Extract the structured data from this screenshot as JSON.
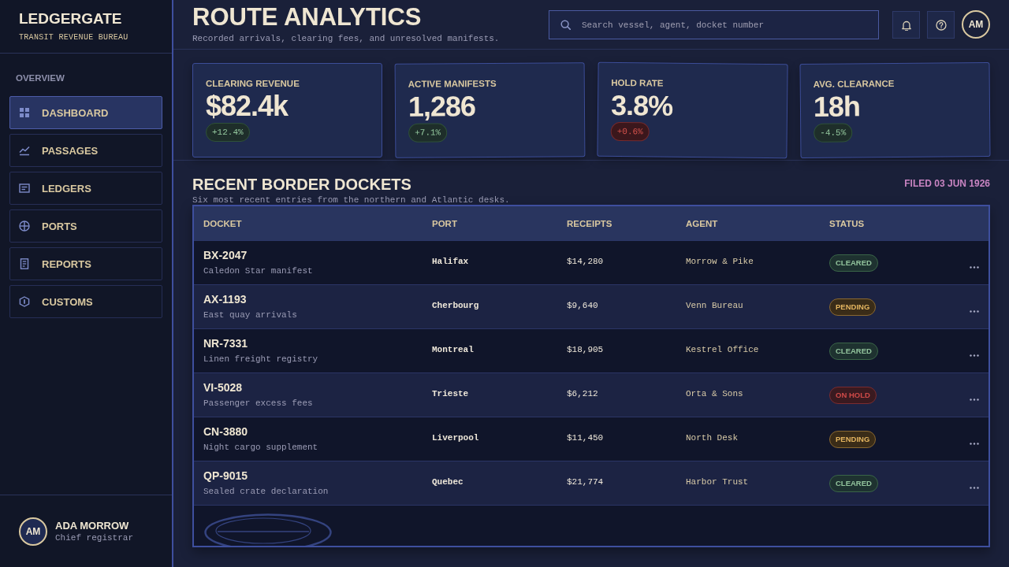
{
  "sidebar": {
    "brand": {
      "name": "LEDGERGATE",
      "tagline": "TRANSIT REVENUE BUREAU"
    },
    "section_label": "OVERVIEW",
    "items": [
      {
        "label": "DASHBOARD",
        "selected": true
      },
      {
        "label": "PASSAGES",
        "selected": false
      },
      {
        "label": "LEDGERS",
        "selected": false
      },
      {
        "label": "PORTS",
        "selected": false
      },
      {
        "label": "REPORTS",
        "selected": false
      },
      {
        "label": "CUSTOMS",
        "selected": false
      }
    ],
    "user": {
      "initials": "AM",
      "name": "ADA MORROW",
      "role": "Chief registrar"
    }
  },
  "header": {
    "title": "ROUTE ANALYTICS",
    "subtitle": "Recorded arrivals, clearing fees, and unresolved manifests.",
    "search": {
      "placeholder": "Search vessel, agent, docket number"
    },
    "account": {
      "initials": "AM"
    }
  },
  "metrics": [
    {
      "label": "CLEARING REVENUE",
      "value": "$82.4k",
      "delta": {
        "text": "+12.4%",
        "kind": "good"
      }
    },
    {
      "label": "ACTIVE MANIFESTS",
      "value": "1,286",
      "delta": {
        "text": "+7.1%",
        "kind": "good"
      }
    },
    {
      "label": "HOLD RATE",
      "value": "3.8%",
      "delta": {
        "text": "+0.6%",
        "kind": "bad"
      }
    },
    {
      "label": "AVG. CLEARANCE",
      "value": "18h",
      "delta": {
        "text": "-4.5%",
        "kind": "good"
      }
    }
  ],
  "dockets": {
    "title": "RECENT BORDER DOCKETS",
    "subtitle": "Six most recent entries from the northern and Atlantic desks.",
    "filed": "FILED 03 JUN 1926",
    "table": {
      "columns": [
        "DOCKET",
        "PORT",
        "RECEIPTS",
        "AGENT",
        "STATUS"
      ],
      "rows": [
        {
          "docket": "BX-2047",
          "description": "Caledon Star manifest",
          "port": "Halifax",
          "receipts": "$14,280",
          "agent": "Morrow & Pike",
          "status": {
            "label": "CLEARED",
            "kind": "cleared"
          }
        },
        {
          "docket": "AX-1193",
          "description": "East quay arrivals",
          "port": "Cherbourg",
          "receipts": "$9,640",
          "agent": "Venn Bureau",
          "status": {
            "label": "PENDING",
            "kind": "pending"
          }
        },
        {
          "docket": "NR-7331",
          "description": "Linen freight registry",
          "port": "Montreal",
          "receipts": "$18,905",
          "agent": "Kestrel Office",
          "status": {
            "label": "CLEARED",
            "kind": "cleared"
          }
        },
        {
          "docket": "VI-5028",
          "description": "Passenger excess fees",
          "port": "Trieste",
          "receipts": "$6,212",
          "agent": "Orta & Sons",
          "status": {
            "label": "ON HOLD",
            "kind": "hold"
          }
        },
        {
          "docket": "CN-3880",
          "description": "Night cargo supplement",
          "port": "Liverpool",
          "receipts": "$11,450",
          "agent": "North Desk",
          "status": {
            "label": "PENDING",
            "kind": "pending"
          }
        },
        {
          "docket": "QP-9015",
          "description": "Sealed crate declaration",
          "port": "Quebec",
          "receipts": "$21,774",
          "agent": "Harbor Trust",
          "status": {
            "label": "CLEARED",
            "kind": "cleared"
          }
        }
      ]
    }
  }
}
